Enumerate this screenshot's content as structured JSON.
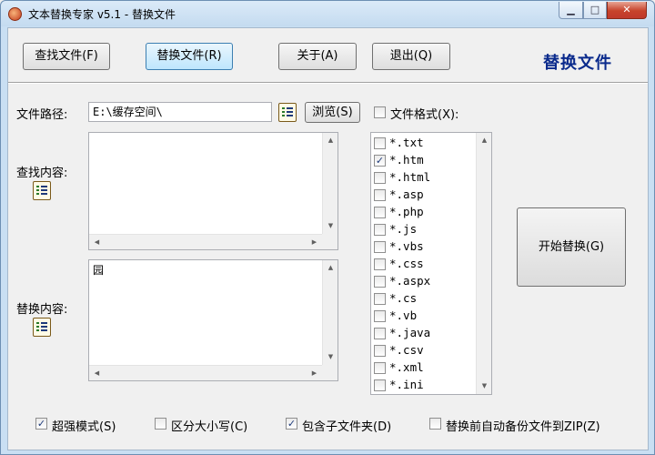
{
  "window": {
    "title": "文本替换专家 v5.1 - 替换文件",
    "minimize_glyph": "▁",
    "maximize_glyph": "□",
    "close_glyph": "✕"
  },
  "toolbar": {
    "find_files": "查找文件(F)",
    "replace_files": "替换文件(R)",
    "about": "关于(A)",
    "exit": "退出(Q)",
    "page_heading": "替换文件"
  },
  "path": {
    "label": "文件路径:",
    "value": "E:\\缓存空间\\",
    "browse_button": "浏览(S)"
  },
  "find": {
    "label": "查找内容:",
    "value": ""
  },
  "replace": {
    "label": "替换内容:",
    "value": "园"
  },
  "file_format": {
    "label": "文件格式(X):",
    "checked": false,
    "items": [
      {
        "ext": "*.txt",
        "checked": false
      },
      {
        "ext": "*.htm",
        "checked": true
      },
      {
        "ext": "*.html",
        "checked": false
      },
      {
        "ext": "*.asp",
        "checked": false
      },
      {
        "ext": "*.php",
        "checked": false
      },
      {
        "ext": "*.js",
        "checked": false
      },
      {
        "ext": "*.vbs",
        "checked": false
      },
      {
        "ext": "*.css",
        "checked": false
      },
      {
        "ext": "*.aspx",
        "checked": false
      },
      {
        "ext": "*.cs",
        "checked": false
      },
      {
        "ext": "*.vb",
        "checked": false
      },
      {
        "ext": "*.java",
        "checked": false
      },
      {
        "ext": "*.csv",
        "checked": false
      },
      {
        "ext": "*.xml",
        "checked": false
      },
      {
        "ext": "*.ini",
        "checked": false
      }
    ]
  },
  "start_button": "开始替换(G)",
  "options": [
    {
      "label": "超强模式(S)",
      "checked": true
    },
    {
      "label": "区分大小写(C)",
      "checked": false
    },
    {
      "label": "包含子文件夹(D)",
      "checked": true
    },
    {
      "label": "替换前自动备份文件到ZIP(Z)",
      "checked": false
    }
  ],
  "icons": {
    "app": "app-icon",
    "list_edit": "list-edit-icon",
    "check_mark": "✓"
  },
  "colors": {
    "heading": "#0a2a8c",
    "title_bar": "#c9dff3",
    "close_button": "#c7432b"
  }
}
